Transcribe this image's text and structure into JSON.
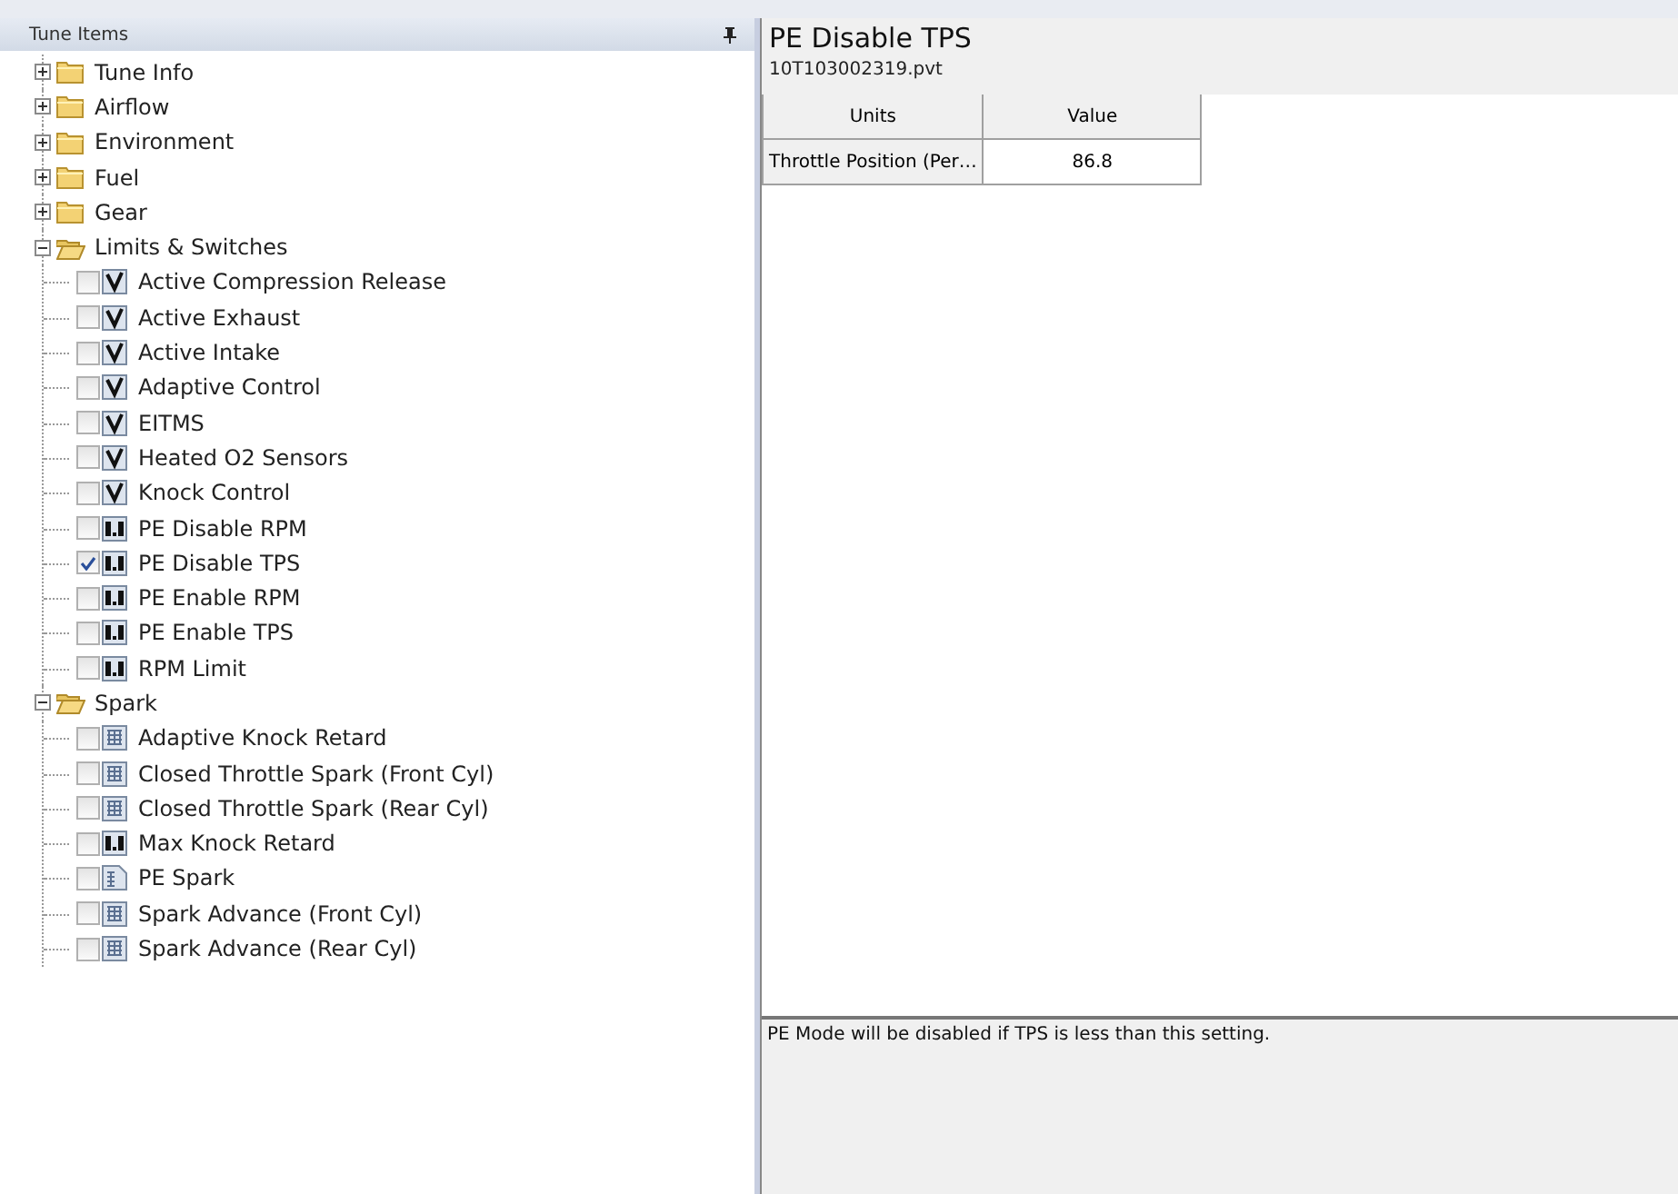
{
  "tree_panel": {
    "title": "Tune Items"
  },
  "tree": [
    {
      "label": "Tune Info",
      "expanded": false
    },
    {
      "label": "Airflow",
      "expanded": false
    },
    {
      "label": "Environment",
      "expanded": false
    },
    {
      "label": "Fuel",
      "expanded": false
    },
    {
      "label": "Gear",
      "expanded": false
    },
    {
      "label": "Limits & Switches",
      "expanded": true,
      "children": [
        {
          "label": "Active Compression Release",
          "kind": "switch",
          "checked": false
        },
        {
          "label": "Active Exhaust",
          "kind": "switch",
          "checked": false
        },
        {
          "label": "Active Intake",
          "kind": "switch",
          "checked": false
        },
        {
          "label": "Adaptive Control",
          "kind": "switch",
          "checked": false
        },
        {
          "label": "EITMS",
          "kind": "switch",
          "checked": false
        },
        {
          "label": "Heated O2 Sensors",
          "kind": "switch",
          "checked": false
        },
        {
          "label": "Knock Control",
          "kind": "switch",
          "checked": false
        },
        {
          "label": "PE Disable RPM",
          "kind": "value",
          "checked": false
        },
        {
          "label": "PE Disable TPS",
          "kind": "value",
          "checked": true
        },
        {
          "label": "PE Enable RPM",
          "kind": "value",
          "checked": false
        },
        {
          "label": "PE Enable TPS",
          "kind": "value",
          "checked": false
        },
        {
          "label": "RPM Limit",
          "kind": "value",
          "checked": false
        }
      ]
    },
    {
      "label": "Spark",
      "expanded": true,
      "children": [
        {
          "label": "Adaptive Knock Retard",
          "kind": "table",
          "checked": false
        },
        {
          "label": "Closed Throttle Spark (Front Cyl)",
          "kind": "table",
          "checked": false
        },
        {
          "label": "Closed Throttle Spark (Rear Cyl)",
          "kind": "table",
          "checked": false
        },
        {
          "label": "Max Knock Retard",
          "kind": "value",
          "checked": false
        },
        {
          "label": "PE Spark",
          "kind": "column",
          "checked": false
        },
        {
          "label": "Spark Advance (Front Cyl)",
          "kind": "table",
          "checked": false
        },
        {
          "label": "Spark Advance (Rear Cyl)",
          "kind": "table",
          "checked": false
        }
      ]
    }
  ],
  "detail": {
    "title": "PE Disable TPS",
    "file": "10T103002319.pvt",
    "table": {
      "columns": [
        "Units",
        "Value"
      ],
      "rows": [
        [
          "Throttle Position (Per…",
          "86.8"
        ]
      ]
    },
    "description": "PE Mode will be disabled if TPS is less than this setting."
  }
}
